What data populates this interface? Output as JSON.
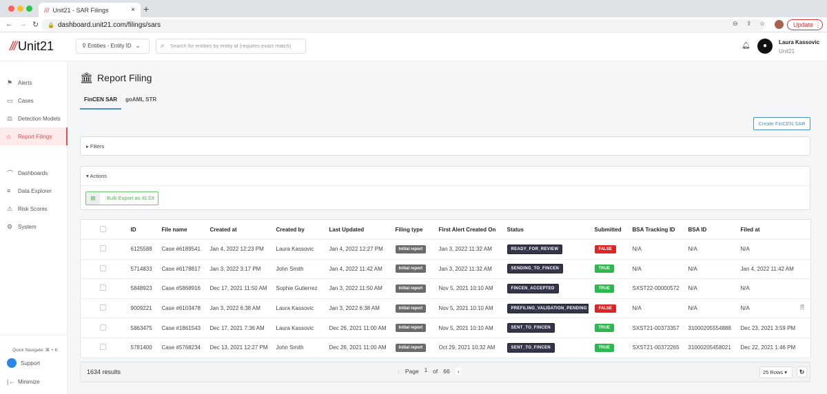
{
  "browser": {
    "tab_title": "Unit21 - SAR Filings",
    "url": "dashboard.unit21.com/filings/sars",
    "update_label": "Update"
  },
  "header": {
    "logo": "Unit21",
    "entity_select": "Entities - Entity ID",
    "search_placeholder": "Search for entities by entity id (requires exact match)",
    "user_name": "Laura Kassovic",
    "user_org": "Unit21"
  },
  "sidebar": {
    "items": [
      {
        "label": "Alerts",
        "icon": "flag-icon"
      },
      {
        "label": "Cases",
        "icon": "briefcase-icon"
      },
      {
        "label": "Detection Models",
        "icon": "scale-icon"
      },
      {
        "label": "Report Filings",
        "icon": "bank-icon",
        "active": true
      },
      {
        "label": "Dashboards",
        "icon": "chart-icon"
      },
      {
        "label": "Data Explorer",
        "icon": "explore-icon"
      },
      {
        "label": "Risk Scores",
        "icon": "warning-icon"
      },
      {
        "label": "System",
        "icon": "gear-icon"
      }
    ],
    "quick_navigate": "Quick Navigate: ⌘ + K",
    "support": "Support",
    "minimize": "Minimize"
  },
  "page": {
    "title": "Report Filing",
    "tabs": [
      "FinCEN SAR",
      "goAML STR"
    ],
    "create_button": "Create FinCEN SAR",
    "filters": "Filters",
    "actions": "Actions",
    "bulk_export": "Bulk Export as XLSX"
  },
  "table": {
    "columns": [
      "ID",
      "File name",
      "Created at",
      "Created by",
      "Last Updated",
      "Filing type",
      "First Alert Created On",
      "Status",
      "Submitted",
      "BSA Tracking ID",
      "BSA ID",
      "Filed at"
    ],
    "rows": [
      [
        "6125588",
        "Case #6189541",
        "Jan 4, 2022 12:23 PM",
        "Laura Kassovic",
        "Jan 4, 2022 12:27 PM",
        "Initial report",
        "Jan 3, 2022 11:32 AM",
        "READY_FOR_REVIEW",
        "FALSE",
        "N/A",
        "N/A",
        "N/A"
      ],
      [
        "5714833",
        "Case #6178817",
        "Jan 3, 2022 3:17 PM",
        "John Smith",
        "Jan 4, 2022 11:42 AM",
        "Initial report",
        "Jan 3, 2022 11:32 AM",
        "SENDING_TO_FINCEN",
        "TRUE",
        "N/A",
        "N/A",
        "Jan 4, 2022 11:42 AM"
      ],
      [
        "5848923",
        "Case #5868916",
        "Dec 17, 2021 11:50 AM",
        "Sophie Gutierrez",
        "Jan 3, 2022 11:50 AM",
        "Initial report",
        "Nov 5, 2021 10:10 AM",
        "FINCEN_ACCEPTED",
        "TRUE",
        "SXST22-00000572",
        "N/A",
        "N/A"
      ],
      [
        "9009221",
        "Case #6103478",
        "Jan 3, 2022 6:38 AM",
        "Laura Kassovic",
        "Jan 3, 2022 6:38 AM",
        "Initial report",
        "Nov 5, 2021 10:10 AM",
        "PREFILING_VALIDATION_PENDING",
        "FALSE",
        "N/A",
        "N/A",
        "N/A"
      ],
      [
        "5863475",
        "Case #1861543",
        "Dec 17, 2021 7:36 AM",
        "Laura Kassovic",
        "Dec 26, 2021 11:00 AM",
        "Initial report",
        "Nov 5, 2021 10:10 AM",
        "SENT_TO_FINCEN",
        "TRUE",
        "SXST21-00373357",
        "31000205554888",
        "Dec 23, 2021 3:59 PM"
      ],
      [
        "5781400",
        "Case #5768234",
        "Dec 13, 2021 12:27 PM",
        "John Smith",
        "Dec 26, 2021 11:00 AM",
        "Initial report",
        "Oct 29, 2021 10:32 AM",
        "SENT_TO_FINCEN",
        "TRUE",
        "SXST21-00372265",
        "31000205458021",
        "Dec 22, 2021 1:46 PM"
      ]
    ]
  },
  "footer": {
    "results": "1634 results",
    "page_label": "Page",
    "page": "1",
    "of_label": "of",
    "total_pages": "66",
    "rows_select": "25 Rows"
  },
  "colors": {
    "true": "#2db84d",
    "false": "#e02424",
    "status": "#34344a",
    "accent": "#e45050",
    "link": "#4a90e2"
  }
}
